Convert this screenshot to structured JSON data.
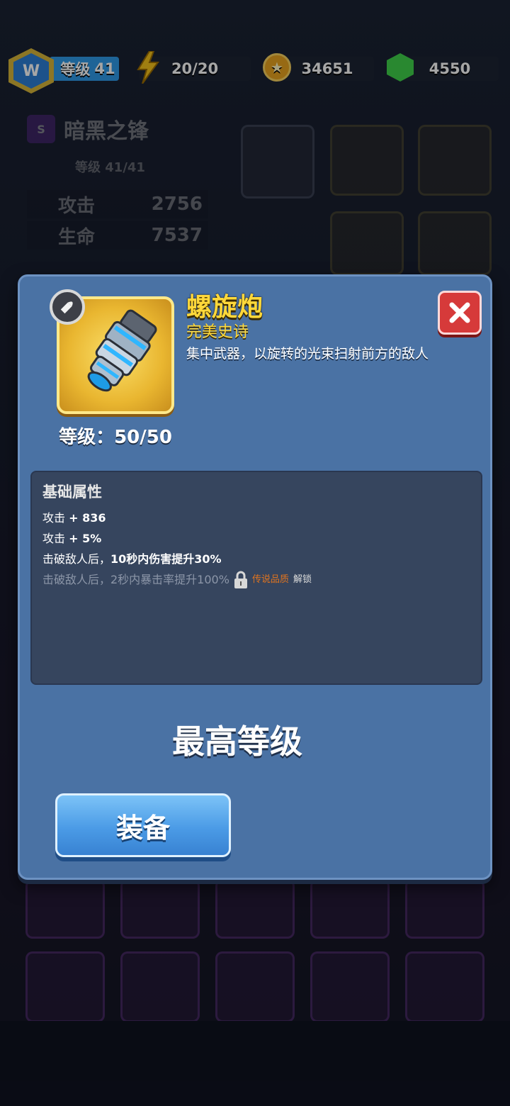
{
  "topbar": {
    "player_level_label": "等级",
    "player_level_value": "41",
    "energy": "20/20",
    "coins": "34651",
    "gems": "4550"
  },
  "hero": {
    "name": "暗黑之锋",
    "level": "等级 41/41",
    "attack_label": "攻击",
    "attack_value": "2756",
    "hp_label": "生命",
    "hp_value": "7537"
  },
  "dialog": {
    "item_name": "螺旋炮",
    "rarity": "完美史诗",
    "description": "集中武器，以旋转的光束扫射前方的敌人",
    "level_text": "等级：50/50",
    "attributes_title": "基础属性",
    "attributes": [
      {
        "label": "攻击 ",
        "value": "+ 836"
      },
      {
        "label": "攻击 ",
        "value": "+ 5%"
      },
      {
        "label": "击破敌人后，",
        "value": "10秒内伤害提升30%"
      }
    ],
    "locked_attribute": {
      "text": "击破敌人后，2秒内暴击率提升100%",
      "requirement": "传说品质",
      "unlock_label": "解锁"
    },
    "max_level_text": "最高等级",
    "equip_label": "装备"
  },
  "colors": {
    "dialog_bg": "#4a72a4",
    "rarity_gold": "#ffd83a",
    "close_red": "#d63a3a",
    "equip_blue": "#4b9be6",
    "legend_orange": "#e0741f"
  },
  "icons": [
    "level-badge-icon",
    "energy-icon",
    "coin-icon",
    "gem-icon",
    "bullet-type-icon",
    "close-icon",
    "lock-icon",
    "spiral-cannon-icon"
  ]
}
